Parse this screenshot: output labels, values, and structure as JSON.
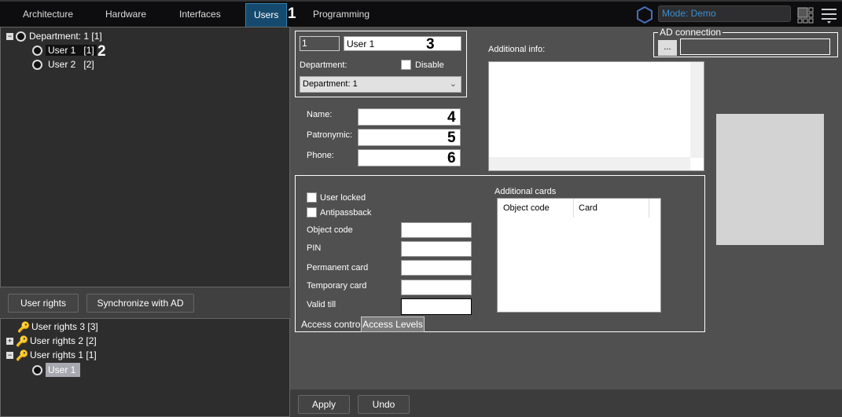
{
  "topbar": {
    "tabs": [
      "Architecture",
      "Hardware",
      "Interfaces",
      "Users",
      "Programming"
    ],
    "active_tab": "Users",
    "mode": "Mode: Demo"
  },
  "markers": [
    "1",
    "2",
    "3",
    "4",
    "5",
    "6"
  ],
  "dept_tree": {
    "department": "Department: 1 [1]",
    "users": [
      {
        "name": "User 1",
        "id": "[1]"
      },
      {
        "name": "User 2",
        "id": "[2]"
      }
    ]
  },
  "buttons": {
    "user_rights": "User rights",
    "sync_ad": "Synchronize with AD",
    "apply": "Apply",
    "undo": "Undo",
    "ad_browse": "..."
  },
  "rights_tree": {
    "items": [
      "User rights 3 [3]",
      "User rights 2 [2]",
      "User rights 1 [1]"
    ],
    "child": "User 1"
  },
  "user_form": {
    "id": "1",
    "name": "User 1",
    "department_label": "Department:",
    "disable_label": "Disable",
    "department_value": "Department: 1",
    "name_label": "Name:",
    "patronymic_label": "Patronymic:",
    "phone_label": "Phone:",
    "additional_info_label": "Additional info:",
    "ad_connection_label": "AD connection"
  },
  "access": {
    "user_locked": "User locked",
    "antipassback": "Antipassback",
    "object_code": "Object code",
    "pin": "PIN",
    "permanent_card": "Permanent card",
    "temporary_card": "Temporary card",
    "valid_till": "Valid till",
    "additional_cards": "Additional cards",
    "columns": [
      "Object code",
      "Card"
    ],
    "tabs": [
      "Access control",
      "Access Levels"
    ]
  }
}
